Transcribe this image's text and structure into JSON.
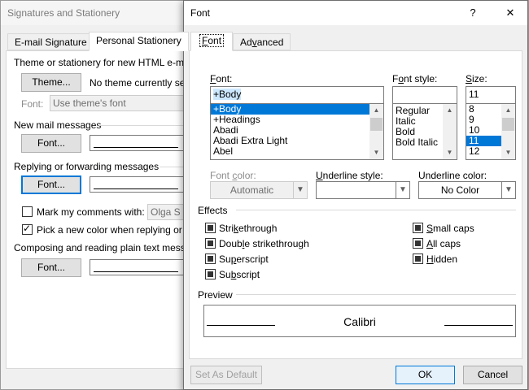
{
  "bg_dialog": {
    "title": "Signatures and Stationery",
    "tabs": [
      "E-mail Signature",
      "Personal Stationery"
    ],
    "theme_heading": "Theme or stationery for new HTML e-mail",
    "theme_button": "Theme...",
    "theme_status": "No theme currently sele",
    "font_label": "Font:",
    "font_value": "Use theme's font",
    "new_mail_heading": "New mail messages",
    "font_button": "Font...",
    "reply_heading": "Replying or forwarding messages",
    "mark_comments_label": "Mark my comments with:",
    "mark_comments_value": "Olga S",
    "pick_color_label": "Pick a new color when replying or fo",
    "plain_text_heading": "Composing and reading plain text messa"
  },
  "font_dialog": {
    "title": "Font",
    "help": "?",
    "close": "✕",
    "tabs": [
      "Font",
      "Advanced"
    ],
    "font_label": "Font:",
    "font_value": "+Body",
    "font_list": [
      "+Body",
      "+Headings",
      "Abadi",
      "Abadi Extra Light",
      "Abel"
    ],
    "style_label": "Font style:",
    "style_value": "",
    "style_list": [
      "Regular",
      "Italic",
      "Bold",
      "Bold Italic"
    ],
    "size_label": "Size:",
    "size_value": "11",
    "size_list": [
      "8",
      "9",
      "10",
      "11",
      "12"
    ],
    "font_color_label": "Font color:",
    "font_color_value": "Automatic",
    "underline_style_label": "Underline style:",
    "underline_style_value": "",
    "underline_color_label": "Underline color:",
    "underline_color_value": "No Color",
    "effects_heading": "Effects",
    "effects": [
      "Strikethrough",
      "Double strikethrough",
      "Superscript",
      "Subscript",
      "Small caps",
      "All caps",
      "Hidden"
    ],
    "preview_heading": "Preview",
    "preview_text": "Calibri",
    "set_default_button": "Set As Default",
    "ok_button": "OK",
    "cancel_button": "Cancel"
  }
}
